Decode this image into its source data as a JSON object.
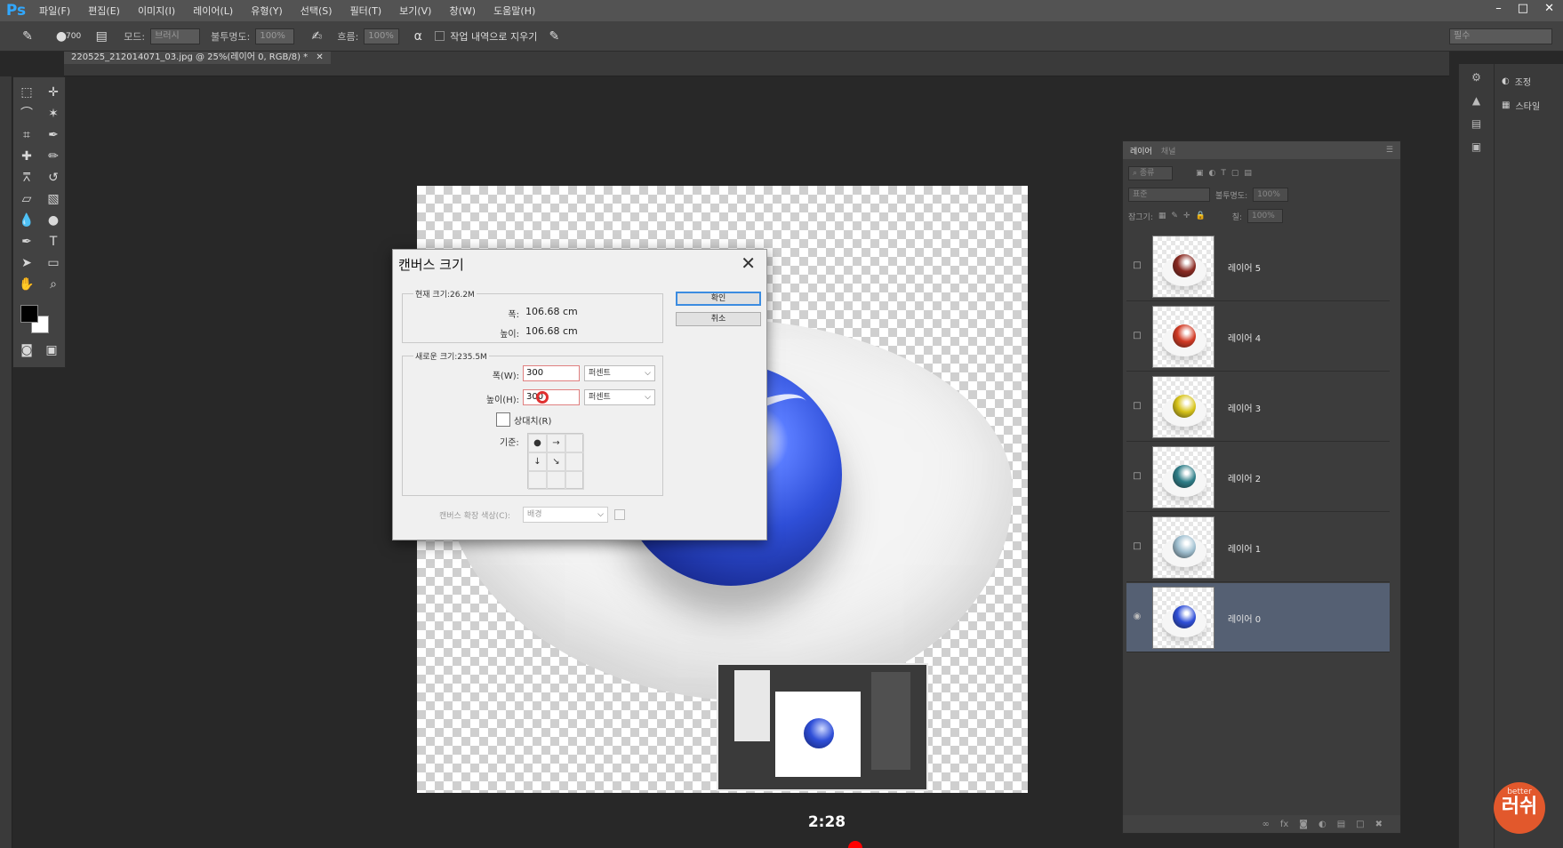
{
  "menu": {
    "logo": "Ps",
    "items": [
      "파일(F)",
      "편집(E)",
      "이미지(I)",
      "레이어(L)",
      "유형(Y)",
      "선택(S)",
      "필터(T)",
      "보기(V)",
      "창(W)",
      "도움말(H)"
    ]
  },
  "options": {
    "brush_size": "700",
    "mode_label": "모드:",
    "mode_value": "브러시",
    "opacity_label": "불투명도:",
    "opacity_value": "100%",
    "flow_label": "흐름:",
    "flow_value": "100%",
    "erase_history_label": "작업 내역으로 지우기",
    "workspace": "필수"
  },
  "document": {
    "tab_title": "220525_212014071_03.jpg @ 25%(레이어 0, RGB/8) *"
  },
  "dialog": {
    "title": "캔버스 크기",
    "current_size_legend": "현재 크기:26.2M",
    "width_label": "폭:",
    "width_value": "106.68 cm",
    "height_label": "높이:",
    "height_value": "106.68 cm",
    "new_size_legend": "새로운 크기:235.5M",
    "new_width_label": "폭(W):",
    "new_width_value": "300",
    "new_height_label": "높이(H):",
    "new_height_value": "300",
    "unit_width": "퍼센트",
    "unit_height": "퍼센트",
    "relative_label": "상대치(R)",
    "anchor_label": "기준:",
    "ext_color_label": "캔버스 확장 색상(C):",
    "ext_color_value": "배경",
    "ok_label": "확인",
    "cancel_label": "취소"
  },
  "layers_panel": {
    "tab_layers": "레이어",
    "tab_channels": "채널",
    "filter_label": "종류",
    "blend_mode": "표준",
    "opacity_label": "불투명도:",
    "opacity_value": "100%",
    "lock_label": "잠그기:",
    "fill_label": "칠:",
    "fill_value": "100%",
    "layers": [
      {
        "name": "레이어 5",
        "color": "#8a2a22"
      },
      {
        "name": "레이어 4",
        "color": "#d23a24"
      },
      {
        "name": "레이어 3",
        "color": "#d8c41a"
      },
      {
        "name": "레이어 2",
        "color": "#2f7e88"
      },
      {
        "name": "레이어 1",
        "color": "#9fbfd0"
      },
      {
        "name": "레이어 0",
        "color": "#2f4fd8"
      }
    ],
    "selected_index": 5
  },
  "dock": {
    "adjust_label": "조정",
    "style_label": "스타일"
  },
  "video": {
    "timestamp": "2:28"
  },
  "watermark": {
    "top": "better",
    "main": "러쉬"
  }
}
